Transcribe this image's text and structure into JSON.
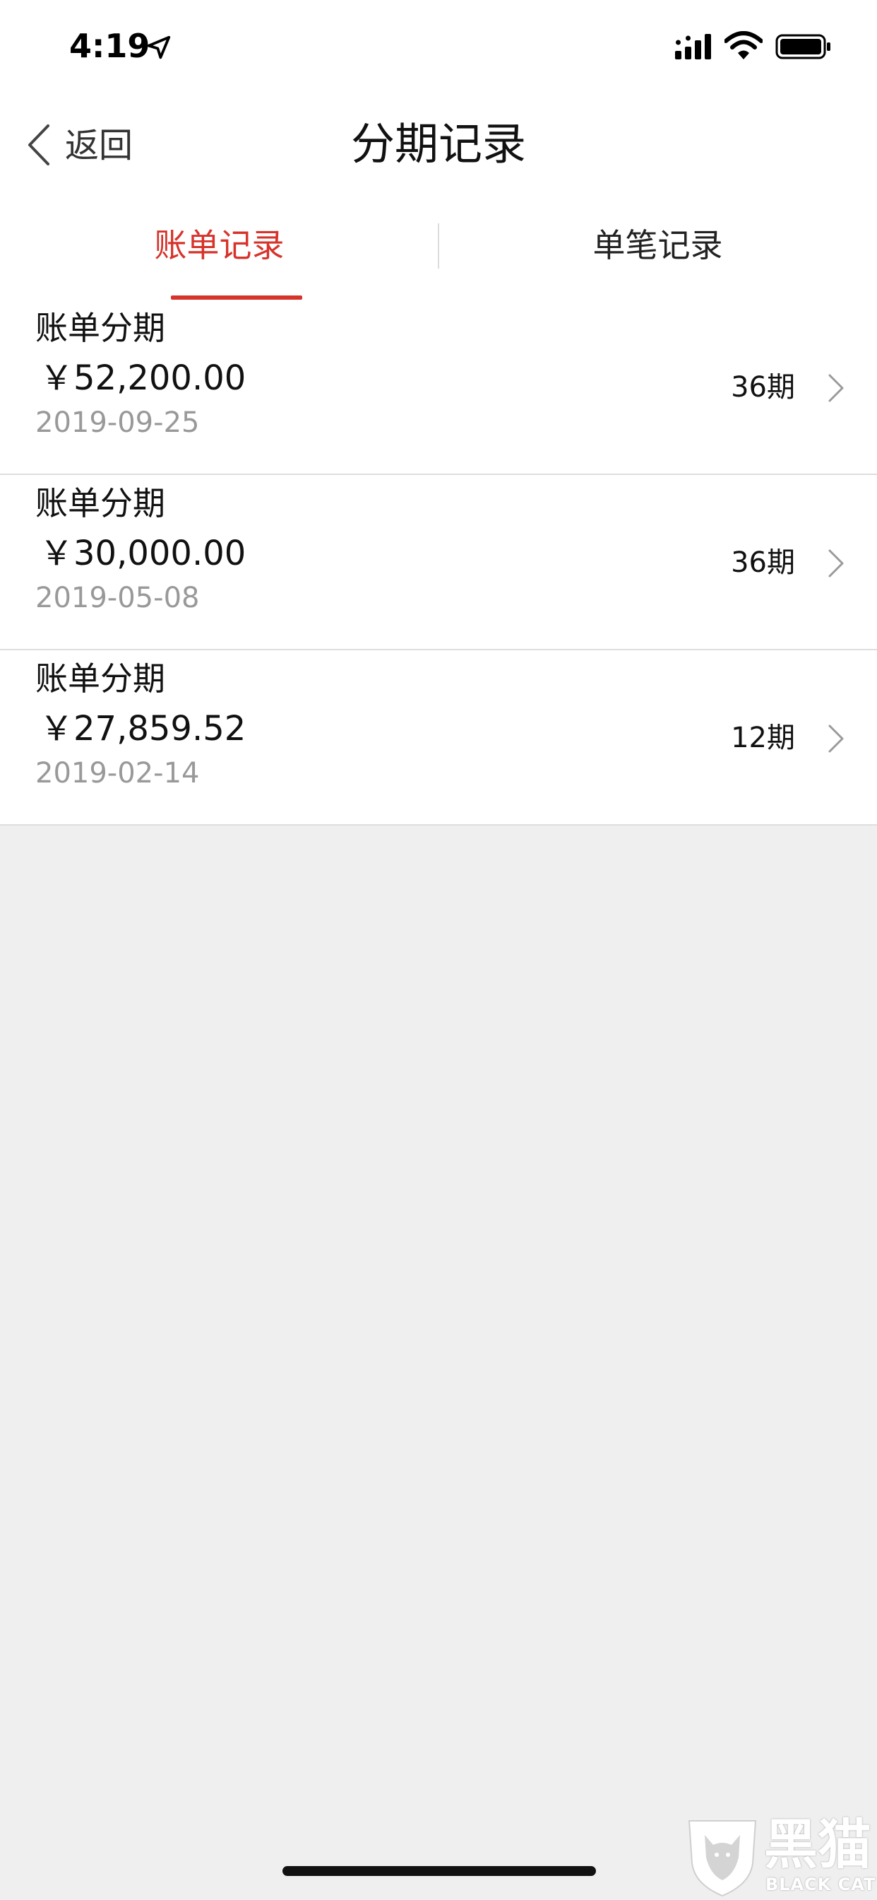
{
  "status_bar": {
    "time": "4:19",
    "icons": [
      "location-arrow-icon",
      "signal-icon",
      "wifi-icon",
      "battery-icon"
    ]
  },
  "nav": {
    "back_label": "返回",
    "title": "分期记录"
  },
  "tabs": [
    {
      "label": "账单记录",
      "active": true
    },
    {
      "label": "单笔记录",
      "active": false
    }
  ],
  "records": [
    {
      "title": "账单分期",
      "amount": "￥52,200.00",
      "date": "2019-09-25",
      "periods": "36期"
    },
    {
      "title": "账单分期",
      "amount": "￥30,000.00",
      "date": "2019-05-08",
      "periods": "36期"
    },
    {
      "title": "账单分期",
      "amount": "￥27,859.52",
      "date": "2019-02-14",
      "periods": "12期"
    }
  ],
  "watermark": {
    "text_cn": "黑猫",
    "text_en": "BLACK CAT"
  },
  "colors": {
    "accent": "#d6342b",
    "background": "#efefef",
    "surface": "#ffffff",
    "muted_text": "#999999"
  }
}
